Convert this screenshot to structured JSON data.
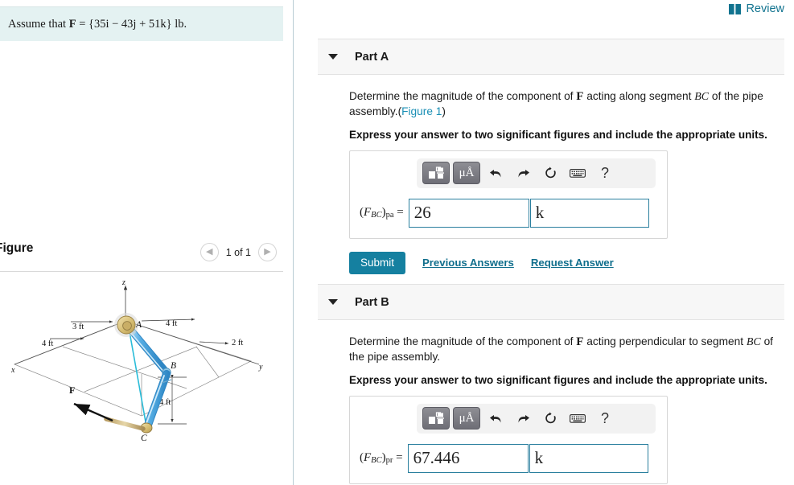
{
  "left": {
    "assume": {
      "prefix": "Assume that ",
      "vector": "F",
      "equals": " = ",
      "expression": "{35i − 43j + 51k}",
      "unit": " lb."
    },
    "figure": {
      "title": "Figure",
      "count": "1 of 1",
      "prev_icon": "chevron-left-icon",
      "next_icon": "chevron-right-icon"
    },
    "diagram": {
      "axes": {
        "x": "x",
        "y": "y",
        "z": "z"
      },
      "points": {
        "a": "A",
        "b": "B",
        "c": "C"
      },
      "force_label": "F",
      "dimensions": {
        "x_near": "3 ft",
        "x_far": "4 ft",
        "y_near": "4 ft",
        "y_far": "2 ft",
        "z_drop": "4 ft"
      },
      "colors": {
        "pipe": "#4aa8e0",
        "pipe_light": "#9fd4f2",
        "hub": "#d8c07a",
        "accent_line": "#29bcd8",
        "guide": "#7a7a7a"
      }
    }
  },
  "right": {
    "review": {
      "label": "Review",
      "icon": "book-icon"
    },
    "parts": [
      {
        "id": "part-a",
        "label": "Part A",
        "caret_icon": "caret-down-icon",
        "prompt_pre": "Determine the magnitude of the component of ",
        "prompt_vector": "F",
        "prompt_mid": " acting along segment ",
        "prompt_segment": "BC",
        "prompt_post": " of the pipe assembly.(",
        "prompt_link": "Figure 1",
        "prompt_end": ")",
        "instruction": "Express your answer to two significant figures and include the appropriate units.",
        "answer": {
          "label_open": "(",
          "label_f": "F",
          "label_sub": "BC",
          "label_close": ")",
          "label_mode": "pa",
          "label_eq": " = ",
          "value": "26",
          "unit": "k"
        },
        "toolbar": {
          "template_icon": "math-template-icon",
          "units_icon": "μÅ",
          "undo_icon": "undo-arrow-icon",
          "redo_icon": "redo-arrow-icon",
          "reset_icon": "reset-circle-icon",
          "keyboard_icon": "keyboard-icon",
          "help_icon": "?"
        },
        "actions": {
          "submit": "Submit",
          "previous": "Previous Answers",
          "request": "Request Answer"
        },
        "show_actions": true
      },
      {
        "id": "part-b",
        "label": "Part B",
        "caret_icon": "caret-down-icon",
        "prompt_pre": "Determine the magnitude of the component of ",
        "prompt_vector": "F",
        "prompt_mid": " acting perpendicular to segment ",
        "prompt_segment": "BC",
        "prompt_post": " of the pipe assembly.",
        "prompt_link": "",
        "prompt_end": "",
        "instruction": "Express your answer to two significant figures and include the appropriate units.",
        "answer": {
          "label_open": "(",
          "label_f": "F",
          "label_sub": "BC",
          "label_close": ")",
          "label_mode": "pr",
          "label_eq": " = ",
          "value": "67.446",
          "unit": "k"
        },
        "toolbar": {
          "template_icon": "math-template-icon",
          "units_icon": "μÅ",
          "undo_icon": "undo-arrow-icon",
          "redo_icon": "redo-arrow-icon",
          "reset_icon": "reset-circle-icon",
          "keyboard_icon": "keyboard-icon",
          "help_icon": "?"
        },
        "actions": {
          "submit": "",
          "previous": "",
          "request": ""
        },
        "show_actions": false
      }
    ]
  },
  "colors": {
    "accent_teal": "#1580a0",
    "link_teal": "#0f6e8c",
    "figure_link": "#1a8fb5",
    "assume_bg": "#e4f2f2",
    "part_header_bg": "#f7f7f7",
    "input_border": "#2a7f9e"
  }
}
